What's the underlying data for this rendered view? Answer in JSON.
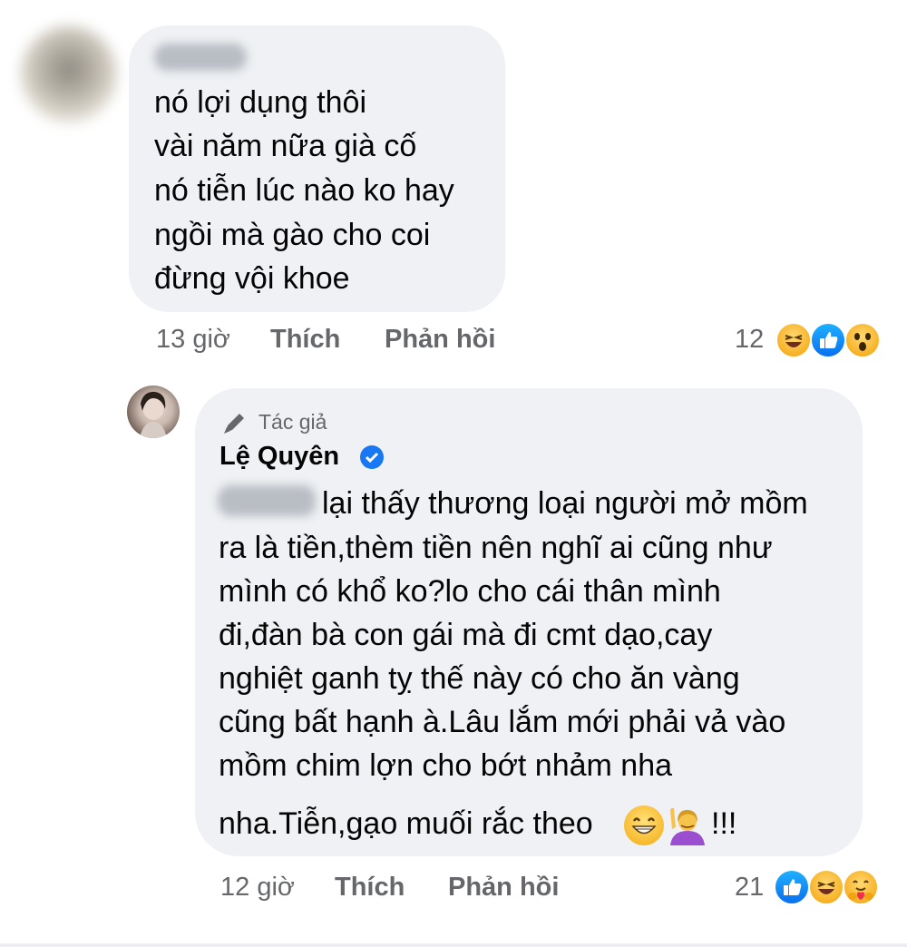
{
  "comment1": {
    "lines": [
      "nó lợi dụng thôi",
      "vài năm nữa già cố",
      "nó tiễn lúc nào ko hay",
      "ngồi mà gào cho coi",
      "đừng vội khoe"
    ],
    "time": "13 giờ",
    "like_label": "Thích",
    "reply_label": "Phản hồi",
    "reaction_count": "12",
    "reactions": [
      "haha-icon",
      "like-icon",
      "wow-icon"
    ]
  },
  "comment2": {
    "author_badge": "Tác giả",
    "author_name": "Lệ Quyên",
    "lines": [
      "lại thấy thương loại người mở mồm",
      "ra là tiền,thèm tiền nên nghĩ ai cũng như",
      "mình có khổ ko?lo cho cái thân mình",
      "đi,đàn bà con gái mà đi cmt dạo,cay",
      "nghiệt ganh tỵ thế này có cho ăn vàng",
      "cũng bất hạnh à.Lâu lắm mới phải vả vào",
      "mồm chim lợn cho bớt nhảm nha",
      "nha.Tiễn,gạo muối rắc theo",
      "!!!"
    ],
    "time": "12 giờ",
    "like_label": "Thích",
    "reply_label": "Phản hồi",
    "reaction_count": "21",
    "reactions": [
      "like-icon",
      "haha-icon",
      "care-icon"
    ]
  },
  "colors": {
    "bubble": "#eff1f4",
    "meta_text": "#65676b",
    "verified_blue": "#1877f2"
  }
}
